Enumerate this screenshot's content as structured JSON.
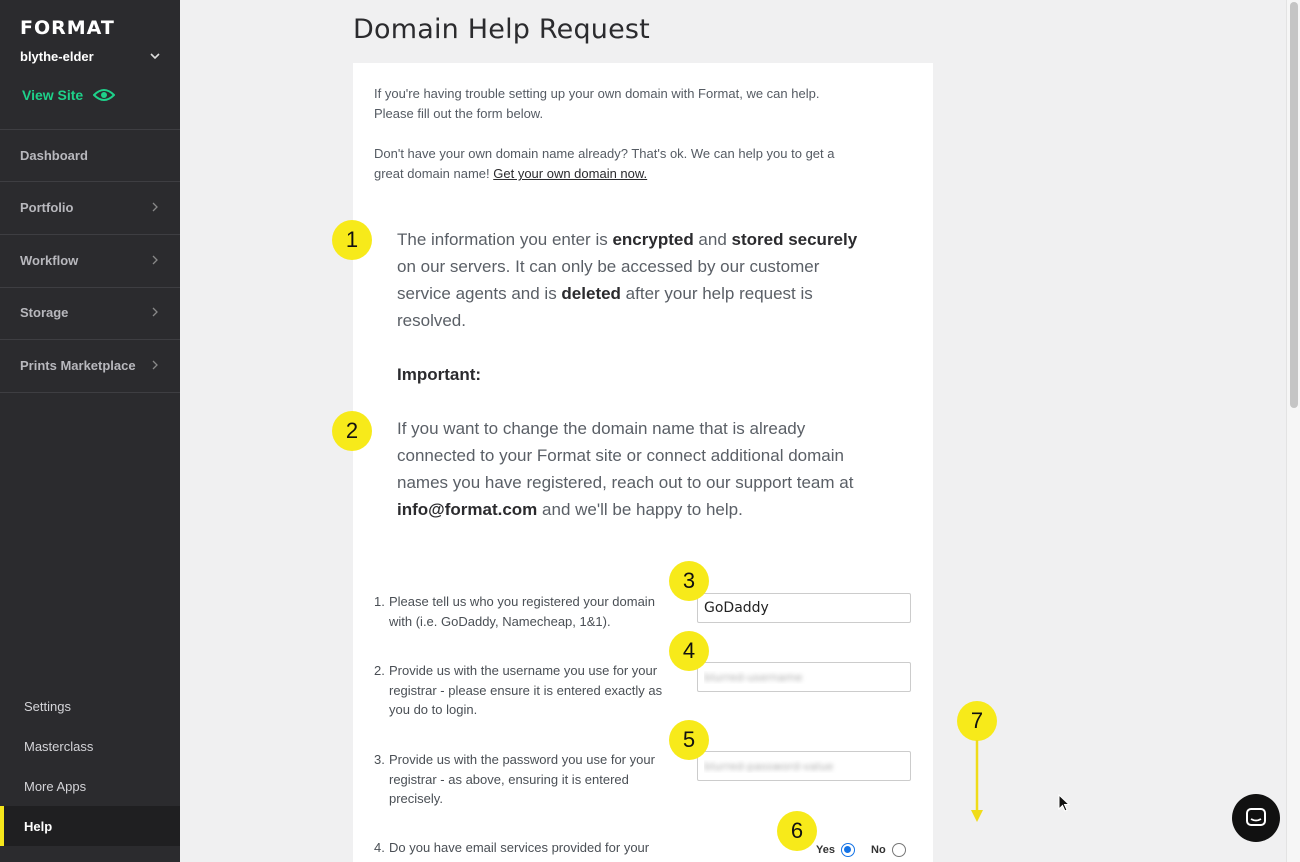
{
  "sidebar": {
    "logo": "FORMAT",
    "site_name": "blythe-elder",
    "view_site": "View Site",
    "nav": [
      {
        "label": "Dashboard",
        "has_arrow": false
      },
      {
        "label": "Portfolio",
        "has_arrow": true
      },
      {
        "label": "Workflow",
        "has_arrow": true
      },
      {
        "label": "Storage",
        "has_arrow": true
      },
      {
        "label": "Prints Marketplace",
        "has_arrow": true
      }
    ],
    "bottom": [
      {
        "label": "Settings"
      },
      {
        "label": "Masterclass"
      },
      {
        "label": "More Apps"
      },
      {
        "label": "Help",
        "active": true
      }
    ]
  },
  "main": {
    "title": "Domain Help Request",
    "intro_1a": "If you're having trouble setting up your own domain with Format, we can help.",
    "intro_1b": "Please fill out the form below.",
    "intro_2a": "Don't have your own domain name already? That's ok. We can help you to get a",
    "intro_2b": "great domain name!",
    "intro_2_link": "Get your own domain now.",
    "notice_1": {
      "t1": "The information you enter is ",
      "b1": "encrypted",
      "t2": " and ",
      "b2": "stored securely",
      "t3": " on our servers. It can only be accessed by our customer service agents and is ",
      "b3": "deleted",
      "t4": " after your help request is resolved."
    },
    "important": "Important:",
    "notice_2": {
      "t1": "If you want to change the domain name that is already connected to your Format site or connect additional domain names you have registered, reach out to our support team at ",
      "b1": "info@format.com",
      "t2": " and we'll be happy to help."
    },
    "questions": [
      {
        "num": "1.",
        "text": "Please tell us who you registered your domain with (i.e. GoDaddy, Namecheap, 1&1)."
      },
      {
        "num": "2.",
        "text": "Provide us with the username you use for your registrar - please ensure it is entered exactly as you do to login."
      },
      {
        "num": "3.",
        "text": "Provide us with the password you use for your registrar - as above, ensuring it is entered precisely."
      },
      {
        "num": "4.",
        "text": "Do you have email services provided for your"
      }
    ],
    "fields": {
      "registrar_value": "GoDaddy",
      "username_value": "blurred-username",
      "password_value": "blurred-password-value"
    },
    "email_radio": {
      "yes": "Yes",
      "no": "No",
      "selected": "Yes"
    }
  },
  "annotations": [
    "1",
    "2",
    "3",
    "4",
    "5",
    "6",
    "7"
  ],
  "colors": {
    "sidebar_bg": "#2b2b2e",
    "accent_green": "#1ed18a",
    "active_yellow": "#f5e61b",
    "badge_yellow": "#f7ea1a",
    "radio_blue": "#1473e6"
  }
}
